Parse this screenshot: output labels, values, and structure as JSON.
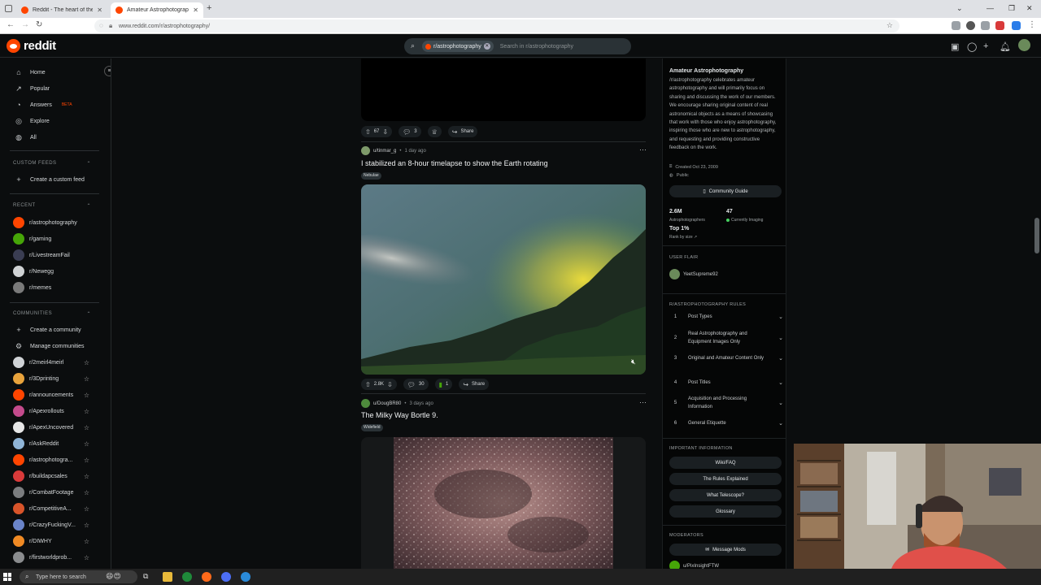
{
  "browser": {
    "tabs": [
      {
        "title": "Reddit - The heart of the intern"
      },
      {
        "title": "Amateur Astrophotography"
      }
    ],
    "new_tab": "+",
    "url": "www.reddit.com/r/astrophotography/"
  },
  "header": {
    "logo": "reddit",
    "search_chip": "r/astrophotography",
    "search_placeholder": "Search in r/astrophotography"
  },
  "sidebar": {
    "nav": [
      {
        "label": "Home",
        "icon": "home-icon"
      },
      {
        "label": "Popular",
        "icon": "popular-icon"
      },
      {
        "label": "Answers",
        "badge": "BETA",
        "icon": "answers-icon"
      },
      {
        "label": "Explore",
        "icon": "explore-icon"
      },
      {
        "label": "All",
        "icon": "all-icon"
      }
    ],
    "custom_feeds_header": "CUSTOM FEEDS",
    "create_custom_feed": "Create a custom feed",
    "recent_header": "RECENT",
    "recent": [
      {
        "name": "r/astrophotography",
        "color": "#ff4500"
      },
      {
        "name": "r/gaming",
        "color": "#46a508"
      },
      {
        "name": "r/LivestreamFail",
        "color": "#3a3d52"
      },
      {
        "name": "r/Newegg",
        "color": "#cfd2d4"
      },
      {
        "name": "r/memes",
        "color": "#7a7a7a"
      }
    ],
    "communities_header": "COMMUNITIES",
    "create_community": "Create a community",
    "manage_communities": "Manage communities",
    "communities": [
      {
        "name": "r/2meirl4meirl",
        "color": "#d0d3d6"
      },
      {
        "name": "r/3Dprinting",
        "color": "#e8a33c"
      },
      {
        "name": "r/announcements",
        "color": "#ff4500"
      },
      {
        "name": "r/Apexrollouts",
        "color": "#c44b8c"
      },
      {
        "name": "r/ApexUncovered",
        "color": "#e6e6e6"
      },
      {
        "name": "r/AskReddit",
        "color": "#8fb4d6"
      },
      {
        "name": "r/astrophotogra...",
        "color": "#ff4500"
      },
      {
        "name": "r/buildapcsales",
        "color": "#d93a3a"
      },
      {
        "name": "r/CombatFootage",
        "color": "#7b7d7f"
      },
      {
        "name": "r/CompetitiveA...",
        "color": "#d8542a"
      },
      {
        "name": "r/CrazyFuckingV...",
        "color": "#6a84c9"
      },
      {
        "name": "r/DIWHY",
        "color": "#f08a24"
      },
      {
        "name": "r/firstworldprob...",
        "color": "#8a8c8e"
      }
    ]
  },
  "feed": {
    "post0_actions": {
      "votes": "67",
      "comments": "3",
      "share": "Share"
    },
    "post1": {
      "author": "u/tinmar_g",
      "time": "1 day ago",
      "title": "I stabilized an 8-hour timelapse to show the Earth rotating",
      "flair": "Nebulae",
      "votes": "2.8K",
      "comments": "30",
      "awards": "1",
      "share": "Share"
    },
    "post2": {
      "author": "u/DougBR80",
      "time": "3 days ago",
      "title": "The Milky Way Bortle 9.",
      "flair": "Widefield"
    },
    "bullet": "•",
    "more": "···"
  },
  "right_sidebar": {
    "name": "Amateur Astrophotography",
    "description": "/r/astrophotography celebrates amateur astrophotography and will primarily focus on sharing and discussing the work of our members. We encourage sharing original content of real astronomical objects as a means of showcasing that work with those who enjoy astrophotography, inspiring those who are new to astrophotography, and requesting and providing constructive feedback on the work.",
    "created": "Created Oct 23, 2009",
    "visibility": "Public",
    "community_guide": "Community Guide",
    "members_count": "2.6M",
    "members_label": "Astrophotographers",
    "online_count": "47",
    "online_label": "Currently Imaging",
    "rank": "Top 1%",
    "rank_label": "Rank by size",
    "user_flair_header": "USER FLAIR",
    "user_flair_name": "YeetSupreme92",
    "rules_header": "R/ASTROPHOTOGRAPHY RULES",
    "rules": [
      {
        "num": "1",
        "text": "Post Types"
      },
      {
        "num": "2",
        "text": "Real Astrophotography and Equipment Images Only"
      },
      {
        "num": "3",
        "text": "Original and Amateur Content Only"
      },
      {
        "num": "4",
        "text": "Post Titles"
      },
      {
        "num": "5",
        "text": "Acquisition and Processing Information"
      },
      {
        "num": "6",
        "text": "General Etiquette"
      }
    ],
    "important_header": "IMPORTANT INFORMATION",
    "important_links": [
      "Wiki/FAQ",
      "The Rules Explained",
      "What Telescope?",
      "Glossary"
    ],
    "moderators_header": "MODERATORS",
    "message_mods": "Message Mods",
    "moderator_1": "u/PixInsightFTW"
  },
  "taskbar": {
    "search_placeholder": "Type here to search"
  },
  "colors": {
    "brand": "#ff4500",
    "background": "#0b0d0e",
    "online_green": "#46d160"
  }
}
